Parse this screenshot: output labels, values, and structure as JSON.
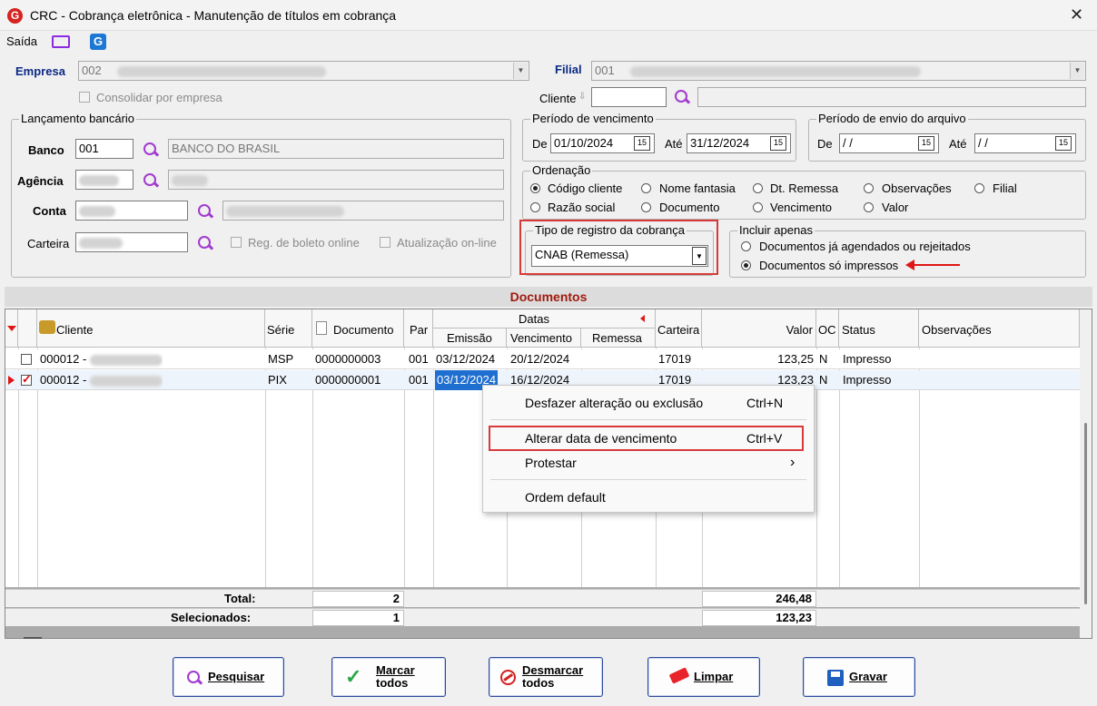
{
  "window": {
    "title": "CRC - Cobrança eletrônica - Manutenção de títulos em cobrança",
    "logo_letter": "G",
    "close": "✕"
  },
  "menu": {
    "saida": "Saída",
    "g_letter": "G"
  },
  "empresa": {
    "label": "Empresa",
    "value": "002"
  },
  "filial": {
    "label": "Filial",
    "value": "001"
  },
  "consolidar": {
    "label": "Consolidar por empresa"
  },
  "cliente": {
    "label": "Cliente"
  },
  "lancamento": {
    "legend": "Lançamento bancário",
    "banco_label": "Banco",
    "banco_value": "001",
    "banco_desc": "BANCO DO BRASIL",
    "agencia_label": "Agência",
    "conta_label": "Conta",
    "carteira_label": "Carteira",
    "reg_boleto": "Reg. de boleto online",
    "atualizacao": "Atualização on-line"
  },
  "periodo_venc": {
    "legend": "Período de vencimento",
    "de_label": "De",
    "de_value": "01/10/2024",
    "ate_label": "Até",
    "ate_value": "31/12/2024",
    "cal_icon": "15"
  },
  "periodo_envio": {
    "legend": "Período de envio do arquivo",
    "de_label": "De",
    "de_value": " / /",
    "ate_label": "Até",
    "ate_value": " / /",
    "cal_icon": "15"
  },
  "ordenacao": {
    "legend": "Ordenação",
    "options": [
      "Código cliente",
      "Nome fantasia",
      "Dt. Remessa",
      "Observações",
      "Filial",
      "Razão social",
      "Documento",
      "Vencimento",
      "Valor"
    ],
    "selected": "Código cliente"
  },
  "tipo_registro": {
    "legend": "Tipo de registro da cobrança",
    "value": "CNAB (Remessa)"
  },
  "incluir": {
    "legend": "Incluir apenas",
    "opt1": "Documentos já agendados ou rejeitados",
    "opt2": "Documentos só impressos",
    "selected": "Documentos só impressos"
  },
  "documentos": {
    "title": "Documentos",
    "headers": {
      "cliente": "Cliente",
      "serie": "Série",
      "documento": "Documento",
      "par": "Par",
      "datas": "Datas",
      "emissao": "Emissão",
      "vencimento": "Vencimento",
      "remessa": "Remessa",
      "carteira": "Carteira",
      "valor": "Valor",
      "oc": "OC",
      "status": "Status",
      "observacoes": "Observações"
    },
    "rows": [
      {
        "checked": false,
        "cliente": "000012 -",
        "serie": "MSP",
        "documento": "0000000003",
        "par": "001",
        "emissao": "03/12/2024",
        "vencimento": "20/12/2024",
        "remessa": "",
        "carteira": "17019",
        "valor": "123,25",
        "oc": "N",
        "status": "Impresso",
        "obs": ""
      },
      {
        "checked": true,
        "cliente": "000012 -",
        "serie": "PIX",
        "documento": "0000000001",
        "par": "001",
        "emissao": "03/12/2024",
        "vencimento": "16/12/2024",
        "remessa": "",
        "carteira": "17019",
        "valor": "123,23",
        "oc": "N",
        "status": "Impresso",
        "obs": ""
      }
    ],
    "total_label": "Total:",
    "total_count": "2",
    "total_valor": "246,48",
    "sel_label": "Selecionados:",
    "sel_count": "1",
    "sel_valor": "123,23"
  },
  "context_menu": {
    "undo": "Desfazer alteração ou exclusão",
    "undo_key": "Ctrl+N",
    "alterar": "Alterar data de vencimento",
    "alterar_key": "Ctrl+V",
    "protestar": "Protestar",
    "submenu_arrow": "›",
    "ordem": "Ordem default"
  },
  "buttons": {
    "pesquisar": "Pesquisar",
    "marcar_l1": "Marcar",
    "marcar_l2": "todos",
    "desmarcar_l1": "Desmarcar",
    "desmarcar_l2": "todos",
    "limpar": "Limpar",
    "gravar": "Gravar"
  },
  "colors": {
    "highlight": "#d83a3a",
    "accent_purple": "#a23ad0",
    "title_blue": "#0b2a85",
    "section_red": "#a01b0e"
  }
}
